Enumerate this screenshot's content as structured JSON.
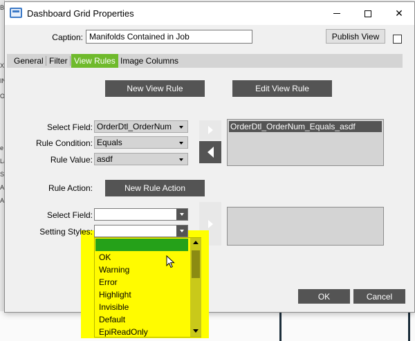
{
  "window": {
    "title": "Dashboard Grid Properties",
    "minimize_icon": "minimize-icon",
    "maximize_icon": "maximize-icon",
    "close_icon": "close-icon",
    "close_glyph": "✕"
  },
  "caption": {
    "label": "Caption:",
    "value": "Manifolds Contained in Job"
  },
  "publish_view": {
    "label": "Publish View",
    "checked": false
  },
  "tabs": [
    {
      "label": "General"
    },
    {
      "label": "Filter"
    },
    {
      "label": "View Rules",
      "active": true
    },
    {
      "label": "Image Columns"
    }
  ],
  "view_rules": {
    "new_view_rule": "New View Rule",
    "edit_view_rule": "Edit View Rule",
    "select_field_label": "Select Field:",
    "select_field_value": "OrderDtl_OrderNum",
    "rule_condition_label": "Rule Condition:",
    "rule_condition_value": "Equals",
    "rule_value_label": "Rule Value:",
    "rule_value_value": "asdf",
    "rules_list": [
      "OrderDtl_OrderNum_Equals_asdf"
    ],
    "rule_action_label": "Rule Action:",
    "new_rule_action": "New Rule Action",
    "action_select_field_label": "Select Field:",
    "action_select_field_value": "",
    "setting_styles_label": "Setting Styles:",
    "setting_styles_value": "",
    "styles_options": [
      "",
      "OK",
      "Warning",
      "Error",
      "Highlight",
      "Invisible",
      "Default",
      "EpiReadOnly"
    ]
  },
  "footer": {
    "ok": "OK",
    "cancel": "Cancel"
  },
  "background": {
    "strip_letters": [
      "B",
      "X",
      "IN",
      "O",
      "e",
      "La",
      "S",
      "AN",
      "AN"
    ]
  },
  "colors": {
    "accent_green": "#6fba2c",
    "dark_button": "#545454",
    "highlight_yellow": "#ffff00",
    "selected_green": "#25a119"
  }
}
